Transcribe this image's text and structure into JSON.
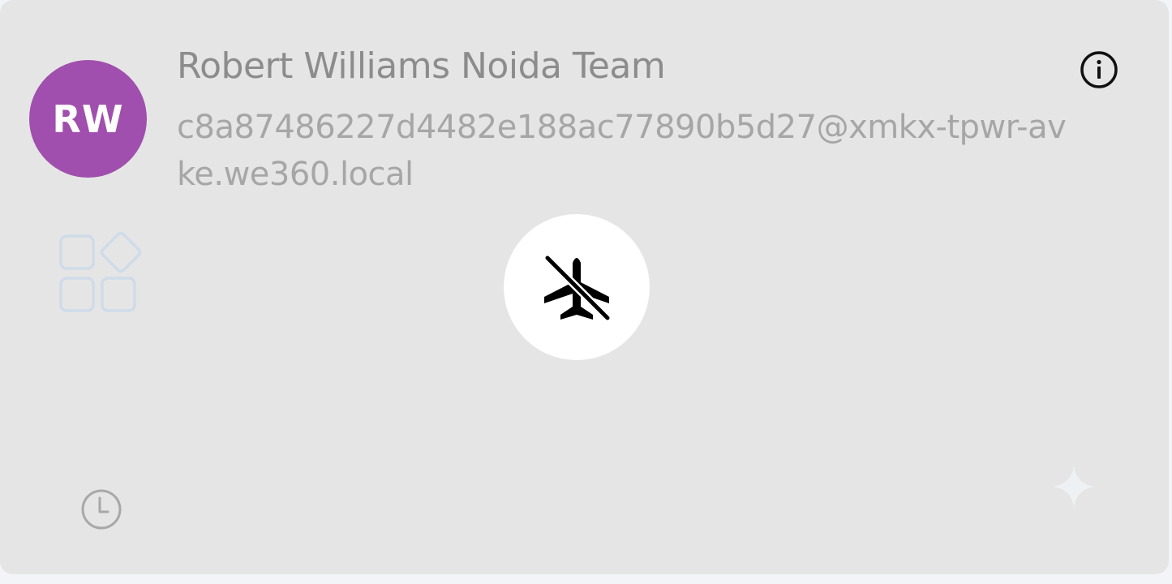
{
  "card": {
    "avatar": {
      "initials": "RW",
      "color": "#a04fae"
    },
    "user": {
      "name": "Robert Williams Noida Team",
      "email": "c8a87486227d4482e188ac77890b5d27@xmkx-tpwr-avke.we360.local"
    },
    "icons": {
      "info": "info-icon",
      "apps": "apps-icon",
      "status": "airplane-off-icon",
      "history": "clock-icon",
      "sparkle": "sparkle-icon"
    },
    "colors": {
      "card_background": "#e5e5e5",
      "name_text": "#8c8c8c",
      "email_text": "#a6a6a6"
    }
  }
}
